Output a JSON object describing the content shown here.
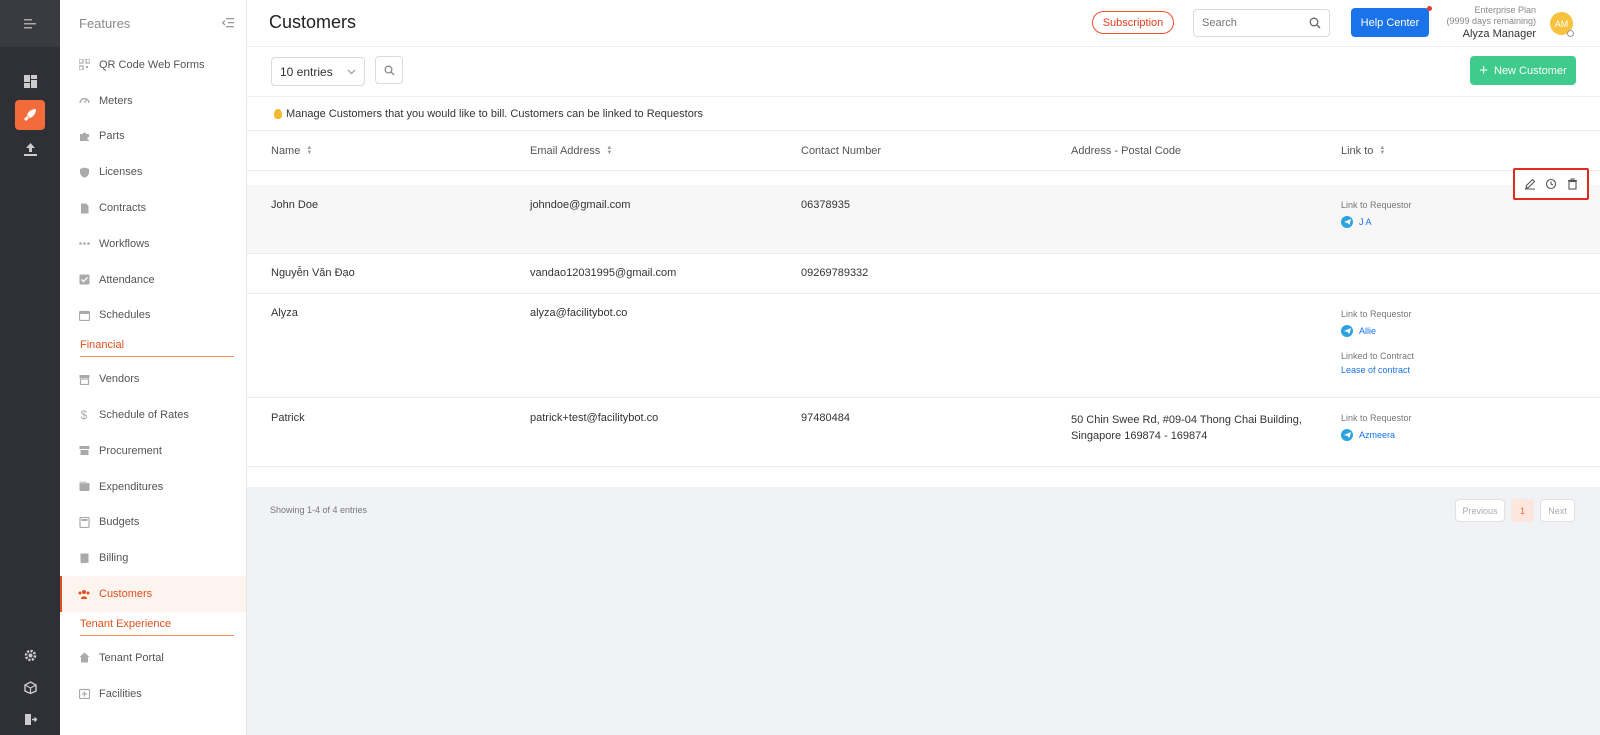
{
  "header": {
    "title": "Customers",
    "subscription_label": "Subscription",
    "search_placeholder": "Search",
    "help_label": "Help Center",
    "plan_name": "Enterprise Plan",
    "plan_days": "(9999 days remaining)",
    "user_name": "Alyza Manager",
    "avatar_initials": "AM"
  },
  "sidebar": {
    "title": "Features",
    "items_a": [
      {
        "label": "QR Code Web Forms",
        "icon": "qr-icon"
      },
      {
        "label": "Meters",
        "icon": "gauge-icon"
      },
      {
        "label": "Parts",
        "icon": "puzzle-icon"
      },
      {
        "label": "Licenses",
        "icon": "shield-icon"
      },
      {
        "label": "Contracts",
        "icon": "document-icon"
      },
      {
        "label": "Workflows",
        "icon": "dots-icon"
      },
      {
        "label": "Attendance",
        "icon": "checkbox-icon"
      },
      {
        "label": "Schedules",
        "icon": "calendar-icon"
      }
    ],
    "section_financial": "Financial",
    "items_b": [
      {
        "label": "Vendors",
        "icon": "store-icon"
      },
      {
        "label": "Schedule of Rates",
        "icon": "dollar-icon"
      },
      {
        "label": "Procurement",
        "icon": "cart-icon"
      },
      {
        "label": "Expenditures",
        "icon": "wallet-icon"
      },
      {
        "label": "Budgets",
        "icon": "calculator-icon"
      },
      {
        "label": "Billing",
        "icon": "receipt-icon"
      },
      {
        "label": "Customers",
        "icon": "people-icon"
      }
    ],
    "section_tenant": "Tenant Experience",
    "items_c": [
      {
        "label": "Tenant Portal",
        "icon": "home-icon"
      },
      {
        "label": "Facilities",
        "icon": "building-icon"
      }
    ]
  },
  "toolbar": {
    "entries_label": "10 entries",
    "new_customer_label": "New Customer"
  },
  "info_text": "Manage Customers that you would like to bill. Customers can be linked to Requestors",
  "table": {
    "columns": [
      "Name",
      "Email Address",
      "Contact Number",
      "Address - Postal Code",
      "Link to"
    ],
    "rows": [
      {
        "name": "John Doe",
        "email": "johndoe@gmail.com",
        "contact": "06378935",
        "address_1": "",
        "address_2": "",
        "link_label": "Link to Requestor",
        "link_value": "J A",
        "contract_label": "",
        "contract_value": ""
      },
      {
        "name": "Nguyễn Văn Đạo",
        "email": "vandao12031995@gmail.com",
        "contact": "09269789332",
        "address_1": "",
        "address_2": "",
        "link_label": "",
        "link_value": "",
        "contract_label": "",
        "contract_value": ""
      },
      {
        "name": "Alyza",
        "email": "alyza@facilitybot.co",
        "contact": "",
        "address_1": "",
        "address_2": "",
        "link_label": "Link to Requestor",
        "link_value": "Allie",
        "contract_label": "Linked to Contract",
        "contract_value": "Lease of contract"
      },
      {
        "name": "Patrick",
        "email": "patrick+test@facilitybot.co",
        "contact": "97480484",
        "address_1": "50 Chin Swee Rd, #09-04 Thong Chai Building,",
        "address_2": "Singapore 169874 - 169874",
        "link_label": "Link to Requestor",
        "link_value": "Azmeera",
        "contract_label": "",
        "contract_value": ""
      }
    ]
  },
  "footer": {
    "showing": "Showing 1-4 of 4 entries",
    "prev_label": "Previous",
    "current_page": "1",
    "next_label": "Next"
  },
  "colors": {
    "accent": "#f26b3a",
    "primary": "#1a73e8",
    "success": "#3ecb8b",
    "highlight": "#e02b20"
  }
}
